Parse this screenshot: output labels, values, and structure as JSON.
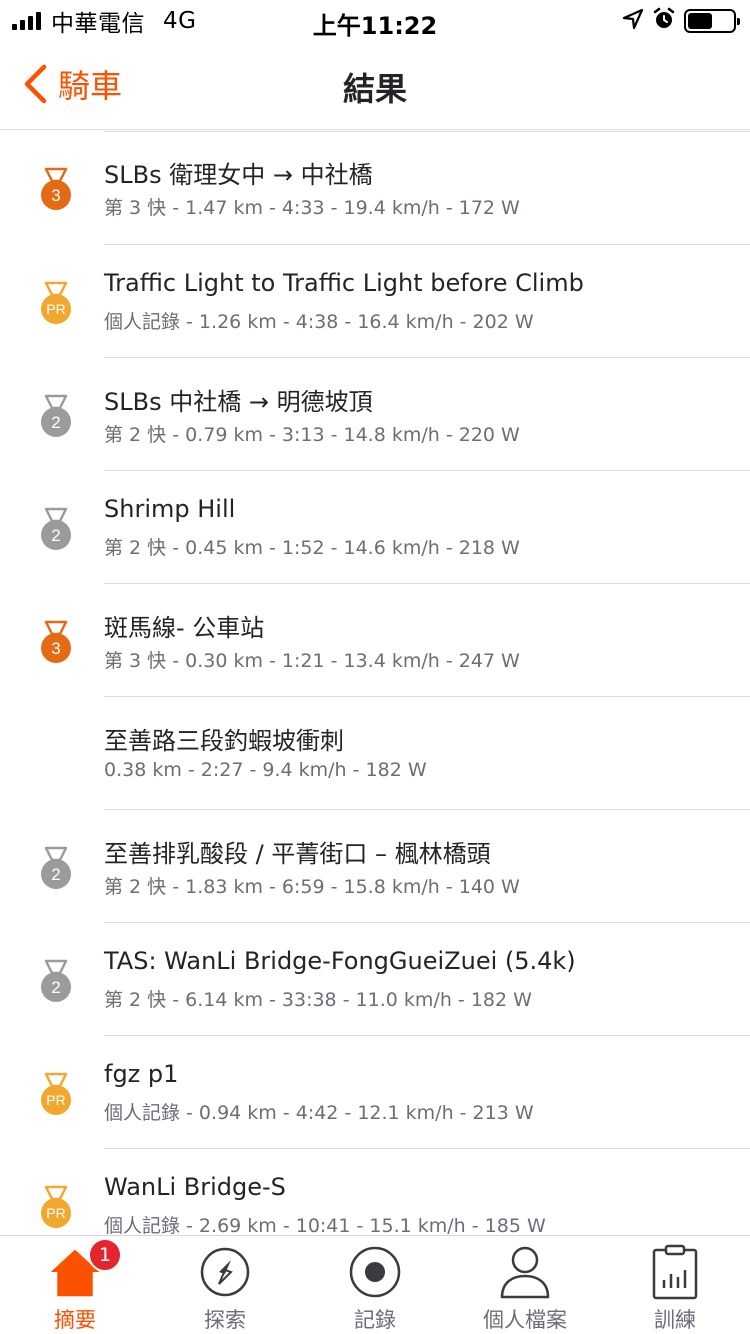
{
  "status_bar": {
    "carrier": "中華電信",
    "network": "4G",
    "time": "上午11:22"
  },
  "nav": {
    "back_label": "騎車",
    "title": "結果"
  },
  "colors": {
    "accent": "#fc5200",
    "gold": "#f2a82f",
    "silver": "#9b9b9b",
    "bronze": "#e36b15"
  },
  "segments": [
    {
      "medal": "bronze",
      "medal_text": "3",
      "title": "SLBs  衛理女中 → 中社橋",
      "subtitle": "第 3 快 - 1.47 km - 4:33 - 19.4 km/h - 172 W"
    },
    {
      "medal": "gold",
      "medal_text": "PR",
      "title": "Traffic Light to Traffic Light before Climb",
      "subtitle": "個人記錄 - 1.26 km - 4:38 - 16.4 km/h - 202 W"
    },
    {
      "medal": "silver",
      "medal_text": "2",
      "title": "SLBs  中社橋 → 明德坡頂",
      "subtitle": "第 2 快 - 0.79 km - 3:13 - 14.8 km/h - 220 W"
    },
    {
      "medal": "silver",
      "medal_text": "2",
      "title": "Shrimp Hill",
      "subtitle": "第 2 快 - 0.45 km - 1:52 - 14.6 km/h - 218 W"
    },
    {
      "medal": "bronze",
      "medal_text": "3",
      "title": "斑馬線- 公車站",
      "subtitle": "第 3 快 - 0.30 km - 1:21 - 13.4 km/h - 247 W"
    },
    {
      "medal": "none",
      "medal_text": "",
      "title": "至善路三段釣蝦坡衝刺",
      "subtitle": "0.38 km - 2:27 - 9.4 km/h - 182 W"
    },
    {
      "medal": "silver",
      "medal_text": "2",
      "title": "至善排乳酸段 / 平菁街口 – 楓林橋頭",
      "subtitle": "第 2 快 - 1.83 km - 6:59 - 15.8 km/h - 140 W"
    },
    {
      "medal": "silver",
      "medal_text": "2",
      "title": "TAS: WanLi Bridge-FongGueiZuei (5.4k)",
      "subtitle": "第 2 快 - 6.14 km - 33:38 - 11.0 km/h - 182 W"
    },
    {
      "medal": "gold",
      "medal_text": "PR",
      "title": "fgz p1",
      "subtitle": "個人記錄 - 0.94 km - 4:42 - 12.1 km/h - 213 W"
    },
    {
      "medal": "gold",
      "medal_text": "PR",
      "title": "WanLi Bridge-S",
      "subtitle": "個人記錄 - 2.69 km - 10:41 - 15.1 km/h - 185 W"
    }
  ],
  "tabs": [
    {
      "label": "摘要",
      "icon": "home-icon",
      "active": true,
      "badge": "1"
    },
    {
      "label": "探索",
      "icon": "compass-icon",
      "active": false
    },
    {
      "label": "記錄",
      "icon": "record-icon",
      "active": false
    },
    {
      "label": "個人檔案",
      "icon": "profile-icon",
      "active": false
    },
    {
      "label": "訓練",
      "icon": "training-icon",
      "active": false
    }
  ]
}
